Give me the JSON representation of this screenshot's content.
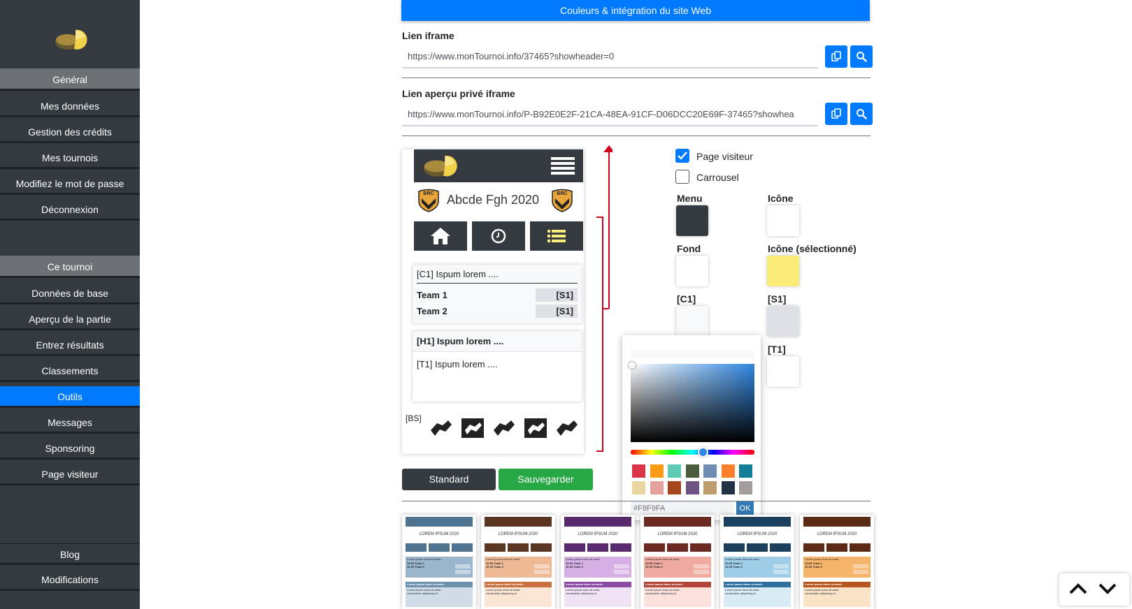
{
  "sidebar": {
    "section1_header": "Général",
    "section1_items": [
      "Mes données",
      "Gestion des crédits",
      "Mes tournois",
      "Modifiez le mot de passe",
      "Déconnexion"
    ],
    "section2_header": "Ce tournoi",
    "section2_items": [
      "Données de base",
      "Aperçu de la partie",
      "Entrez résultats",
      "Classements",
      "Outils",
      "Messages",
      "Sponsoring",
      "Page visiteur"
    ],
    "active_item": "Outils",
    "bottom_items": [
      "Blog",
      "Modifications"
    ]
  },
  "header": {
    "title": "Couleurs & intégration du site Web"
  },
  "iframe_link": {
    "label": "Lien iframe",
    "value": "https://www.monTournoi.info/37465?showheader=0"
  },
  "private_link": {
    "label": "Lien aperçu privé iframe",
    "value": "https://www.monTournoi.info/P-B92E0E2F-21CA-48EA-91CF-D06DCC20E69F-37465?showhea"
  },
  "preview": {
    "title": "Abcde Fgh 2020",
    "badge": "BRC",
    "card1_header": "[C1] Ispum lorem ....",
    "team1": "Team 1",
    "team2": "Team 2",
    "score_label": "[S1]",
    "card2_header": "[H1] Ispum lorem ....",
    "card2_body": "[T1] Ispum lorem ....",
    "bs_label": "[BS]"
  },
  "options": {
    "page_visiteur": {
      "label": "Page visiteur",
      "checked": true
    },
    "carrousel": {
      "label": "Carrousel",
      "checked": false
    }
  },
  "colors": {
    "menu_label": "Menu",
    "icone_label": "Icône",
    "fond_label": "Fond",
    "icone_sel_label": "Icône (sélectionné)",
    "c1_label": "[C1]",
    "s1_label": "[S1]",
    "t1_label": "[T1]",
    "menu": "#343a40",
    "icone": "#ffffff",
    "fond": "#ffffff",
    "icone_sel": "#fbec77",
    "c1": "#f8f9fa",
    "s1": "#dee2e6",
    "t1": "#ffffff",
    "accent": "#007bff",
    "save": "#28a745"
  },
  "picker": {
    "hex_value": "#F8F9FA",
    "ok_label": "OK",
    "palette": [
      "#dc3545",
      "#fd9a13",
      "#5fcbb5",
      "#4b5d3c",
      "#6f8db4",
      "#fd7e2b",
      "#137d9a",
      "#e9d6a0",
      "#e5a19c",
      "#a5471c",
      "#6f5483",
      "#bf9e6e",
      "#233146",
      "#a59d9b"
    ]
  },
  "buttons": {
    "standard": "Standard",
    "save": "Sauvegarder"
  },
  "themes": {
    "title": "LOREM IPSUM 2020",
    "card_line1": "Lorem ipsum dolor sit amet..",
    "row1": "10:00 Team 1",
    "row2": "10:25 Team 2",
    "card2_head": "Lorem ipsum dolor sit amet..",
    "card2_body1": "Lorem ipsum dolor sit amet,",
    "card2_body2": "consectetur adipiscing el.",
    "items": [
      {
        "bar": "#4f7492",
        "nav": "#4f7492",
        "c1": "#9ab6cc",
        "s1": "#c6d6e2",
        "h1": "#6c91ae",
        "t1": "#d0dde8"
      },
      {
        "bar": "#5a3522",
        "nav": "#5a3522",
        "c1": "#f0b996",
        "s1": "#f6d6c3",
        "h1": "#c9713e",
        "t1": "#fbe6d6"
      },
      {
        "bar": "#5a2a6e",
        "nav": "#5a2a6e",
        "c1": "#d6b0e4",
        "s1": "#e8d2f0",
        "h1": "#8a4aa6",
        "t1": "#f0e2f5"
      },
      {
        "bar": "#6a2a22",
        "nav": "#6a2a22",
        "c1": "#f0aaa0",
        "s1": "#f6cdc6",
        "h1": "#b3463a",
        "t1": "#fbe0dc"
      },
      {
        "bar": "#1c3f5e",
        "nav": "#1c3f5e",
        "c1": "#9fcce6",
        "s1": "#c6e1f0",
        "h1": "#2d6f9e",
        "t1": "#d9ecf6"
      },
      {
        "bar": "#5a2a14",
        "nav": "#5a2a14",
        "c1": "#f5b46a",
        "s1": "#f8d2a6",
        "h1": "#b6561e",
        "t1": "#fbe3c8"
      }
    ]
  }
}
